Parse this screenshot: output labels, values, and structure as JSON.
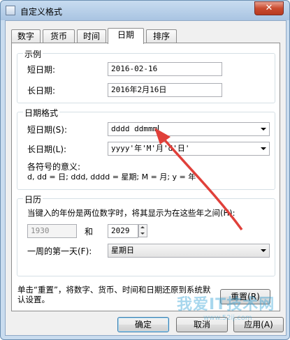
{
  "window": {
    "title": "自定义格式",
    "close_glyph": "✕"
  },
  "tabs": [
    "数字",
    "货币",
    "时间",
    "日期",
    "排序"
  ],
  "active_tab": "日期",
  "example": {
    "legend": "示例",
    "short_label": "短日期:",
    "short_value": "2016-02-16",
    "long_label": "长日期:",
    "long_value": "2016年2月16日"
  },
  "date_format": {
    "legend": "日期格式",
    "short_label": "短日期(S):",
    "short_value": "dddd ddmmm",
    "long_label": "长日期(L):",
    "long_value": "yyyy'年'M'月'd'日'",
    "meaning_title": "各符号的意义:",
    "meaning_text": "d, dd = 日;  ddd, dddd = 星期;  M = 月;  y = 年"
  },
  "calendar": {
    "legend": "日历",
    "two_digit_text": "当键入的年份是两位数字时，将其显示为在这些年之间(H):",
    "year_from": "1930",
    "and_label": "和",
    "year_to": "2029",
    "first_day_label": "一周的第一天(F):",
    "first_day_value": "星期日"
  },
  "reset": {
    "note": "单击“重置”，将数字、货币、时间和日期还原到系统默认设置。",
    "button": "重置(R)"
  },
  "buttons": {
    "ok": "确定",
    "cancel": "取消",
    "apply": "应用(A)"
  },
  "watermark": {
    "text": "我爱IT技术网",
    "url": "www.52ij.com"
  },
  "colors": {
    "arrow": "#e0403a",
    "titlebar": "#c8dcf0",
    "close": "#c94b2f"
  }
}
